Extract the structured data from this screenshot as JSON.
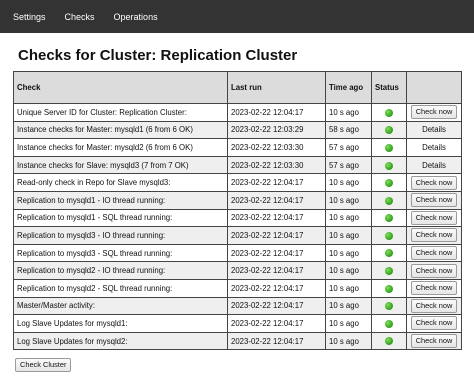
{
  "nav": [
    "Settings",
    "Checks",
    "Operations"
  ],
  "page_title": "Checks for Cluster: Replication Cluster",
  "columns": [
    "Check",
    "Last run",
    "Time ago",
    "Status",
    ""
  ],
  "rows": [
    {
      "check": "Unique Server ID for Cluster: Replication Cluster:",
      "last_run": "2023-02-22 12:04:17",
      "time_ago": "10 s ago",
      "status": "ok",
      "action": "Check now"
    },
    {
      "check": "Instance checks for Master: mysqld1 (6 from 6 OK)",
      "last_run": "2023-02-22 12:03:29",
      "time_ago": "58 s ago",
      "status": "ok",
      "action": "Details"
    },
    {
      "check": "Instance checks for Master: mysqld2 (6 from 6 OK)",
      "last_run": "2023-02-22 12:03:30",
      "time_ago": "57 s ago",
      "status": "ok",
      "action": "Details"
    },
    {
      "check": "Instance checks for Slave: mysqld3 (7 from 7 OK)",
      "last_run": "2023-02-22 12:03:30",
      "time_ago": "57 s ago",
      "status": "ok",
      "action": "Details"
    },
    {
      "check": "Read-only check in Repo for Slave mysqld3:",
      "last_run": "2023-02-22 12:04:17",
      "time_ago": "10 s ago",
      "status": "ok",
      "action": "Check now"
    },
    {
      "check": "Replication to mysqld1 - IO thread running:",
      "last_run": "2023-02-22 12:04:17",
      "time_ago": "10 s ago",
      "status": "ok",
      "action": "Check now"
    },
    {
      "check": "Replication to mysqld1 - SQL thread running:",
      "last_run": "2023-02-22 12:04:17",
      "time_ago": "10 s ago",
      "status": "ok",
      "action": "Check now"
    },
    {
      "check": "Replication to mysqld3 - IO thread running:",
      "last_run": "2023-02-22 12:04:17",
      "time_ago": "10 s ago",
      "status": "ok",
      "action": "Check now"
    },
    {
      "check": "Replication to mysqld3 - SQL thread running:",
      "last_run": "2023-02-22 12:04:17",
      "time_ago": "10 s ago",
      "status": "ok",
      "action": "Check now"
    },
    {
      "check": "Replication to mysqld2 - IO thread running:",
      "last_run": "2023-02-22 12:04:17",
      "time_ago": "10 s ago",
      "status": "ok",
      "action": "Check now"
    },
    {
      "check": "Replication to mysqld2 - SQL thread running:",
      "last_run": "2023-02-22 12:04:17",
      "time_ago": "10 s ago",
      "status": "ok",
      "action": "Check now"
    },
    {
      "check": "Master/Master activity:",
      "last_run": "2023-02-22 12:04:17",
      "time_ago": "10 s ago",
      "status": "ok",
      "action": "Check now"
    },
    {
      "check": "Log Slave Updates for mysqld1:",
      "last_run": "2023-02-22 12:04:17",
      "time_ago": "10 s ago",
      "status": "ok",
      "action": "Check now"
    },
    {
      "check": "Log Slave Updates for mysqld2:",
      "last_run": "2023-02-22 12:04:17",
      "time_ago": "10 s ago",
      "status": "ok",
      "action": "Check now"
    }
  ],
  "status_icon": "green-status-icon",
  "status_color": "#3fae28",
  "check_cluster_label": "Check Cluster"
}
